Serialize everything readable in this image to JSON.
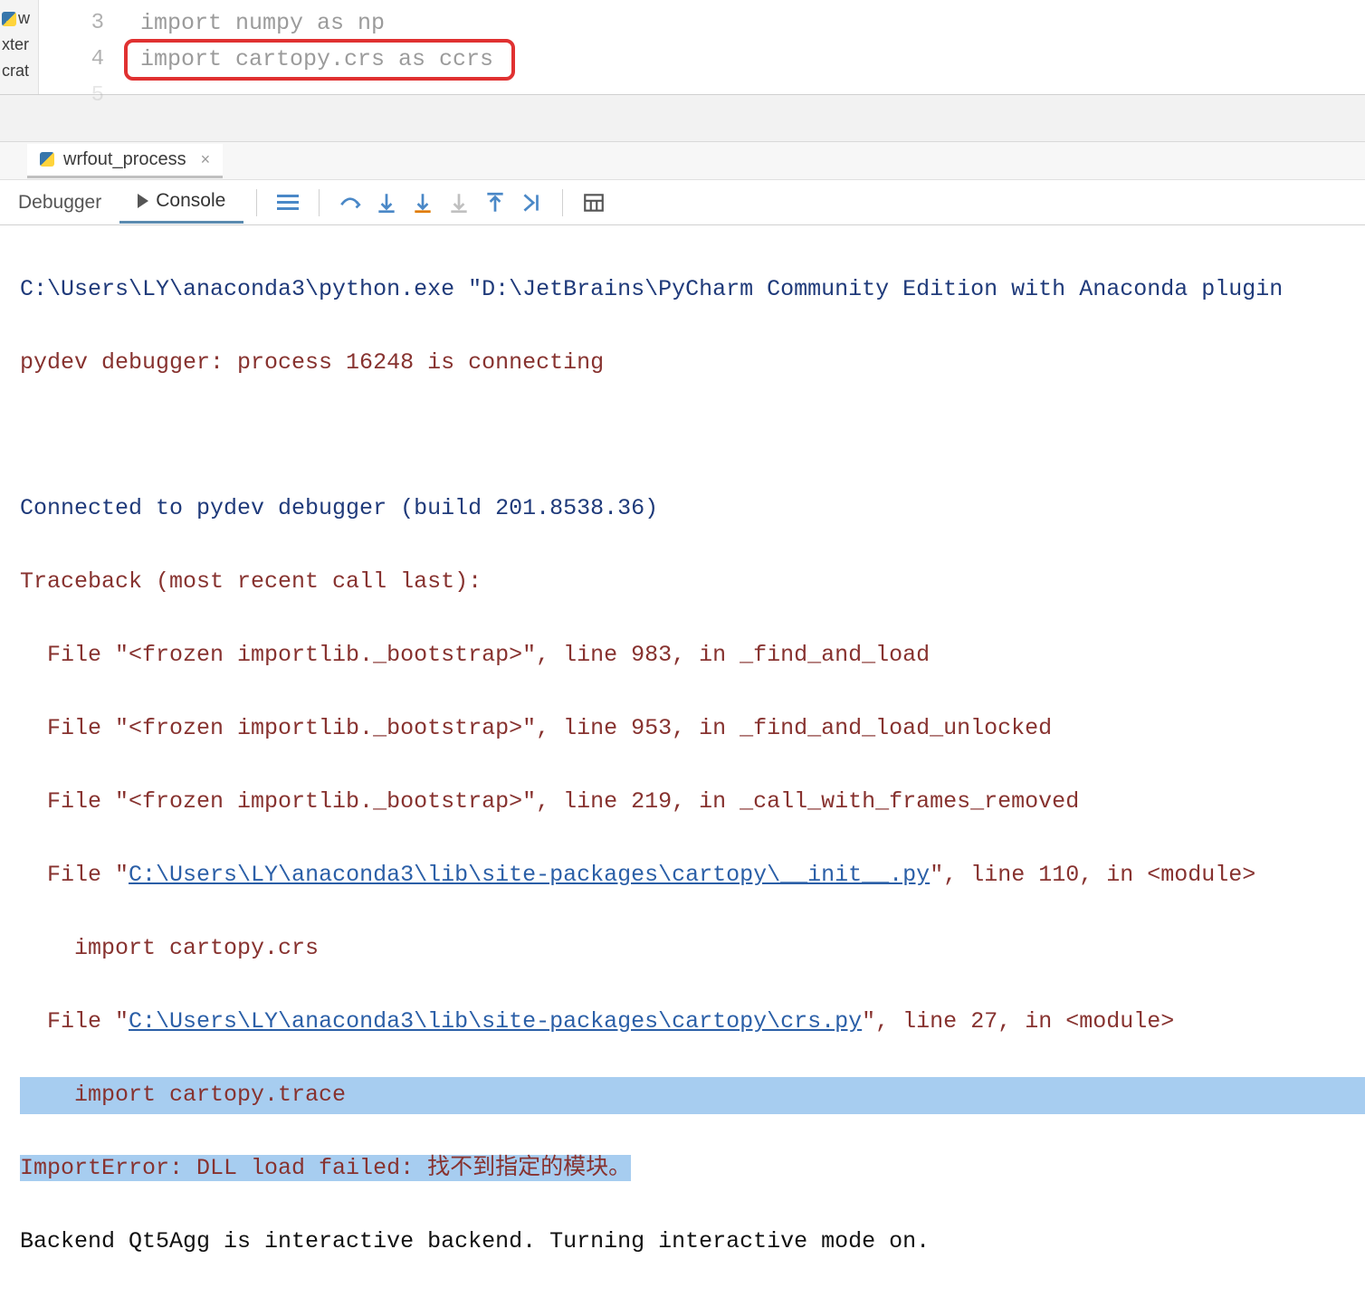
{
  "left_tabs": [
    "w",
    "xter",
    "crat"
  ],
  "editor": {
    "lines": [
      {
        "num": "3",
        "text": "import numpy as np"
      },
      {
        "num": "4",
        "text": "import cartopy.crs as ccrs"
      },
      {
        "num": "5",
        "text": ""
      }
    ]
  },
  "run_tab": {
    "label": "wrfout_process"
  },
  "tool_tabs": {
    "debugger": "Debugger",
    "console": "Console"
  },
  "console": {
    "l0": "C:\\Users\\LY\\anaconda3\\python.exe \"D:\\JetBrains\\PyCharm Community Edition with Anaconda plugin",
    "l1": "pydev debugger: process 16248 is connecting",
    "l2": "Connected to pydev debugger (build 201.8538.36)",
    "l3": "Traceback (most recent call last):",
    "l4": "  File \"<frozen importlib._bootstrap>\", line 983, in _find_and_load",
    "l5": "  File \"<frozen importlib._bootstrap>\", line 953, in _find_and_load_unlocked",
    "l6": "  File \"<frozen importlib._bootstrap>\", line 219, in _call_with_frames_removed",
    "l7a": "  File \"",
    "l7link": "C:\\Users\\LY\\anaconda3\\lib\\site-packages\\cartopy\\__init__.py",
    "l7b": "\", line 110, in <module>",
    "l8": "    import cartopy.crs",
    "l9a": "  File \"",
    "l9link": "C:\\Users\\LY\\anaconda3\\lib\\site-packages\\cartopy\\crs.py",
    "l9b": "\", line 27, in <module>",
    "l10": "    import cartopy.trace",
    "l11": "ImportError: DLL load failed: 找不到指定的模块。",
    "l12": "Backend Qt5Agg is interactive backend. Turning interactive mode on."
  }
}
